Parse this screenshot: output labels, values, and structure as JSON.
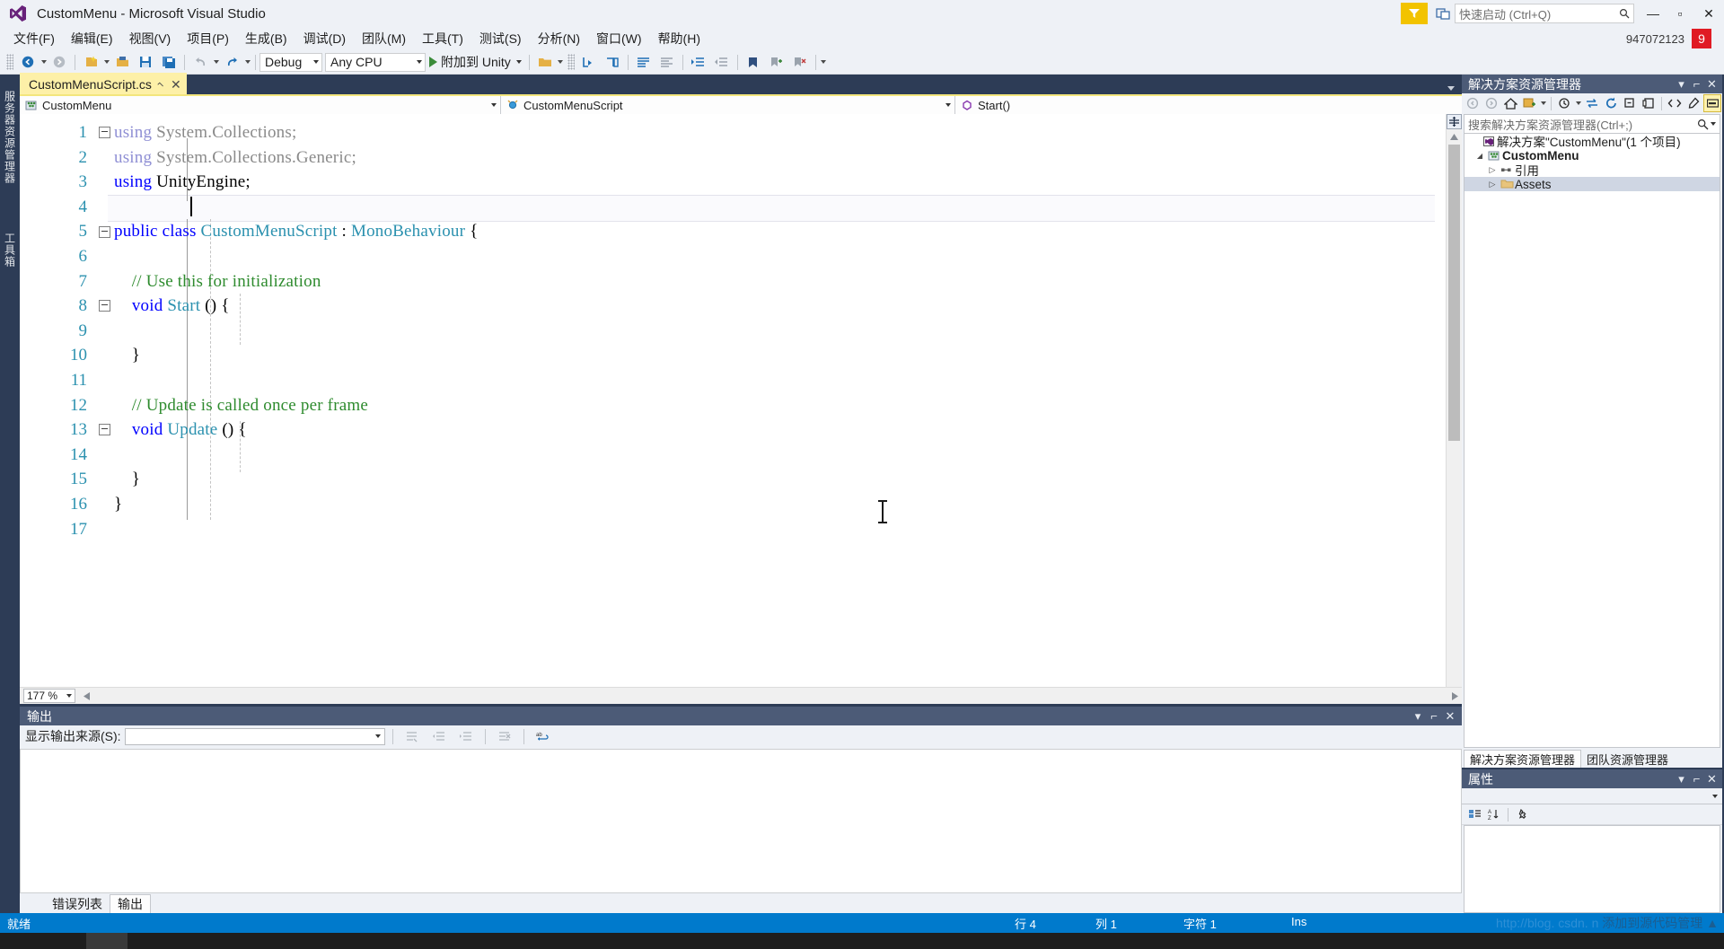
{
  "window": {
    "title": "CustomMenu - Microsoft Visual Studio",
    "quick_launch_placeholder": "快速启动 (Ctrl+Q)",
    "minimize": "—",
    "maximize": "▫",
    "close": "✕",
    "account_name": "947072123",
    "account_badge": "9"
  },
  "menu": {
    "items": [
      {
        "label": "文件(F)"
      },
      {
        "label": "编辑(E)"
      },
      {
        "label": "视图(V)"
      },
      {
        "label": "项目(P)"
      },
      {
        "label": "生成(B)"
      },
      {
        "label": "调试(D)"
      },
      {
        "label": "团队(M)"
      },
      {
        "label": "工具(T)"
      },
      {
        "label": "测试(S)"
      },
      {
        "label": "分析(N)"
      },
      {
        "label": "窗口(W)"
      },
      {
        "label": "帮助(H)"
      }
    ]
  },
  "toolbar": {
    "configuration": "Debug",
    "platform": "Any CPU",
    "run_label": "附加到 Unity"
  },
  "left_rail": {
    "tabs": [
      "服务器资源管理器",
      "工具箱"
    ]
  },
  "editor": {
    "tab_name": "CustomMenuScript.cs",
    "pin_glyph": "⌐",
    "close_glyph": "✕",
    "nav": {
      "project": "CustomMenu",
      "type": "CustomMenuScript",
      "member": "Start()"
    },
    "zoom": "177 %",
    "lines": [
      {
        "n": "1",
        "fold": "minus",
        "dim": true,
        "tokens": [
          {
            "t": "using ",
            "c": "kw"
          },
          {
            "t": "System.Collections;",
            "c": "pln"
          }
        ]
      },
      {
        "n": "2",
        "fold": "bar",
        "dim": true,
        "tokens": [
          {
            "t": "using ",
            "c": "kw"
          },
          {
            "t": "System.Collections.Generic;",
            "c": "pln"
          }
        ]
      },
      {
        "n": "3",
        "fold": "bar",
        "dim": false,
        "tokens": [
          {
            "t": "using ",
            "c": "kw"
          },
          {
            "t": "UnityEngine;",
            "c": "pln"
          }
        ]
      },
      {
        "n": "4",
        "fold": "barend",
        "dim": false,
        "tokens": []
      },
      {
        "n": "5",
        "fold": "minus",
        "dim": false,
        "tokens": [
          {
            "t": "public ",
            "c": "kw"
          },
          {
            "t": "class ",
            "c": "kw"
          },
          {
            "t": "CustomMenuScript",
            "c": "typ"
          },
          {
            "t": " : ",
            "c": "pln"
          },
          {
            "t": "MonoBehaviour",
            "c": "typ"
          },
          {
            "t": " {",
            "c": "pln"
          }
        ]
      },
      {
        "n": "6",
        "fold": "bar",
        "dim": false,
        "tokens": []
      },
      {
        "n": "7",
        "fold": "bar",
        "dim": false,
        "tokens": [
          {
            "t": "    // Use this for initialization",
            "c": "cmt"
          }
        ]
      },
      {
        "n": "8",
        "fold": "minus2",
        "dim": false,
        "tokens": [
          {
            "t": "    ",
            "c": "pln"
          },
          {
            "t": "void ",
            "c": "kw"
          },
          {
            "t": "Start",
            "c": "typ"
          },
          {
            "t": " () {",
            "c": "pln"
          }
        ]
      },
      {
        "n": "9",
        "fold": "bar",
        "dim": false,
        "tokens": []
      },
      {
        "n": "10",
        "fold": "bar",
        "dim": false,
        "tokens": [
          {
            "t": "    }",
            "c": "pln"
          }
        ]
      },
      {
        "n": "11",
        "fold": "bar",
        "dim": false,
        "tokens": []
      },
      {
        "n": "12",
        "fold": "bar",
        "dim": false,
        "tokens": [
          {
            "t": "    // Update is called once per frame",
            "c": "cmt"
          }
        ]
      },
      {
        "n": "13",
        "fold": "minus2",
        "dim": false,
        "tokens": [
          {
            "t": "    ",
            "c": "pln"
          },
          {
            "t": "void ",
            "c": "kw"
          },
          {
            "t": "Update",
            "c": "typ"
          },
          {
            "t": " () {",
            "c": "pln"
          }
        ]
      },
      {
        "n": "14",
        "fold": "bar",
        "dim": false,
        "tokens": []
      },
      {
        "n": "15",
        "fold": "bar",
        "dim": false,
        "tokens": [
          {
            "t": "    }",
            "c": "pln"
          }
        ]
      },
      {
        "n": "16",
        "fold": "end",
        "dim": false,
        "tokens": [
          {
            "t": "}",
            "c": "pln"
          }
        ]
      },
      {
        "n": "17",
        "fold": "none",
        "dim": false,
        "tokens": []
      }
    ]
  },
  "output": {
    "title": "输出",
    "source_label": "显示输出来源(S):",
    "source_value": "",
    "tabs": [
      {
        "label": "错误列表",
        "active": false
      },
      {
        "label": "输出",
        "active": true
      }
    ],
    "minimize": "▾",
    "pin": "⌐",
    "close": "✕"
  },
  "solution_explorer": {
    "title": "解决方案资源管理器",
    "minimize": "▾",
    "pin": "⌐",
    "close": "✕",
    "search_placeholder": "搜索解决方案资源管理器(Ctrl+;)",
    "tree": [
      {
        "label": "解决方案\"CustomMenu\"(1 个项目)",
        "arrow": "",
        "icon": "solution-icon",
        "indent": 0,
        "bold": false,
        "selected": false
      },
      {
        "label": "CustomMenu",
        "arrow": "▲",
        "icon": "project-icon",
        "indent": 1,
        "bold": true,
        "selected": false
      },
      {
        "label": "引用",
        "arrow": "▷",
        "icon": "references-icon",
        "indent": 2,
        "bold": false,
        "selected": false
      },
      {
        "label": "Assets",
        "arrow": "▷",
        "icon": "folder-icon",
        "indent": 2,
        "bold": false,
        "selected": true
      }
    ],
    "tabs": [
      {
        "label": "解决方案资源管理器",
        "active": true
      },
      {
        "label": "团队资源管理器",
        "active": false
      }
    ]
  },
  "properties": {
    "title": "属性",
    "minimize": "▾",
    "pin": "⌐",
    "close": "✕",
    "selected": ""
  },
  "status_bar": {
    "state": "就绪",
    "line": "行 4",
    "column": "列 1",
    "character": "字符 1",
    "insert_mode": "Ins",
    "watermark": "http://blog. csdn. n",
    "watermark_tail": "添加到源代码管理 ▲"
  },
  "colors": {
    "accent": "#007acc",
    "panel_header": "#4c5b77",
    "chrome": "#eef1f6",
    "tab_active": "#fdf0a8",
    "dock_bg": "#2d3c56"
  }
}
